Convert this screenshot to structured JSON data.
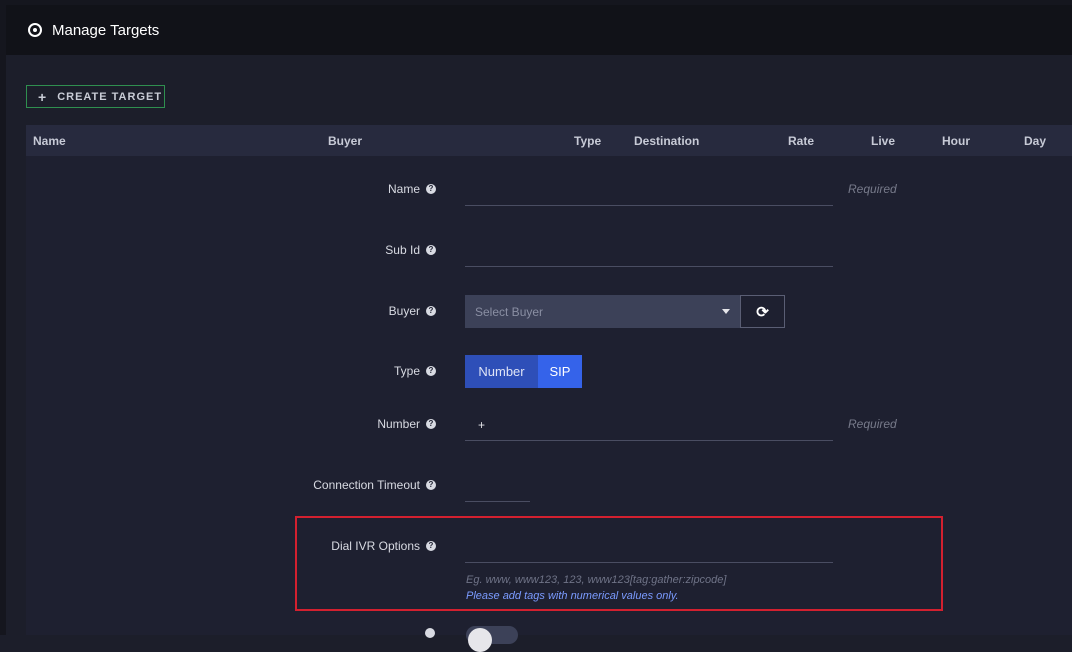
{
  "header": {
    "title": "Manage Targets",
    "icon": "target-icon"
  },
  "toolbar": {
    "create_label": "CREATE TARGET"
  },
  "table": {
    "columns": [
      "Name",
      "Buyer",
      "Type",
      "Destination",
      "Rate",
      "Live",
      "Hour",
      "Day"
    ]
  },
  "form": {
    "name": {
      "label": "Name",
      "value": "",
      "hint": "Required"
    },
    "sub_id": {
      "label": "Sub Id",
      "value": ""
    },
    "buyer": {
      "label": "Buyer",
      "placeholder": "Select Buyer"
    },
    "type": {
      "label": "Type",
      "options": [
        "Number",
        "SIP"
      ],
      "selected": "SIP"
    },
    "number": {
      "label": "Number",
      "value": "+",
      "hint": "Required"
    },
    "connection_timeout": {
      "label": "Connection Timeout",
      "value": ""
    },
    "dial_ivr": {
      "label": "Dial IVR Options",
      "value": "",
      "example": "Eg. www, www123, 123, www123[tag:gather:zipcode]",
      "note": "Please add tags with numerical values only."
    }
  },
  "colors": {
    "accent": "#3563ea",
    "highlight": "#d3202f",
    "create_border": "#2f8f4f"
  }
}
